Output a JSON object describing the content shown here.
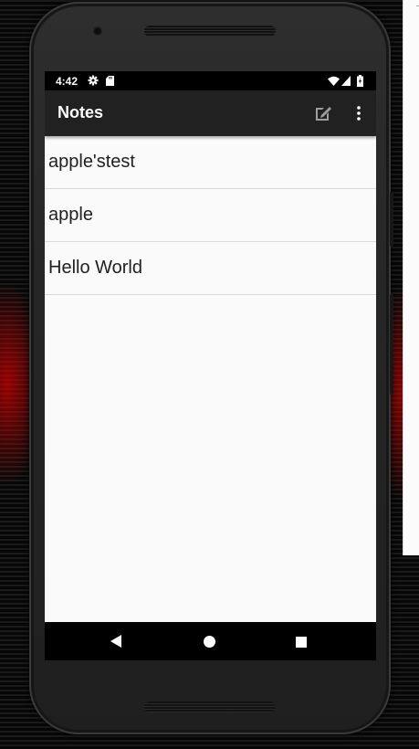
{
  "status_bar": {
    "time": "4:42",
    "icons": [
      "gear-icon",
      "sd-card-icon",
      "wifi-icon",
      "signal-icon",
      "battery-icon"
    ]
  },
  "app_bar": {
    "title": "Notes",
    "actions": [
      "new-note-icon",
      "overflow-menu-icon"
    ]
  },
  "notes": [
    {
      "title": "apple'stest"
    },
    {
      "title": "apple"
    },
    {
      "title": "Hello World"
    }
  ],
  "nav_bar": {
    "buttons": [
      "back-icon",
      "home-icon",
      "recents-icon"
    ]
  },
  "colors": {
    "app_bar": "#212121",
    "status_bar": "#000000",
    "list_background": "#fafafa",
    "divider": "#d9d9d9",
    "accent_glow": "#c80000"
  }
}
